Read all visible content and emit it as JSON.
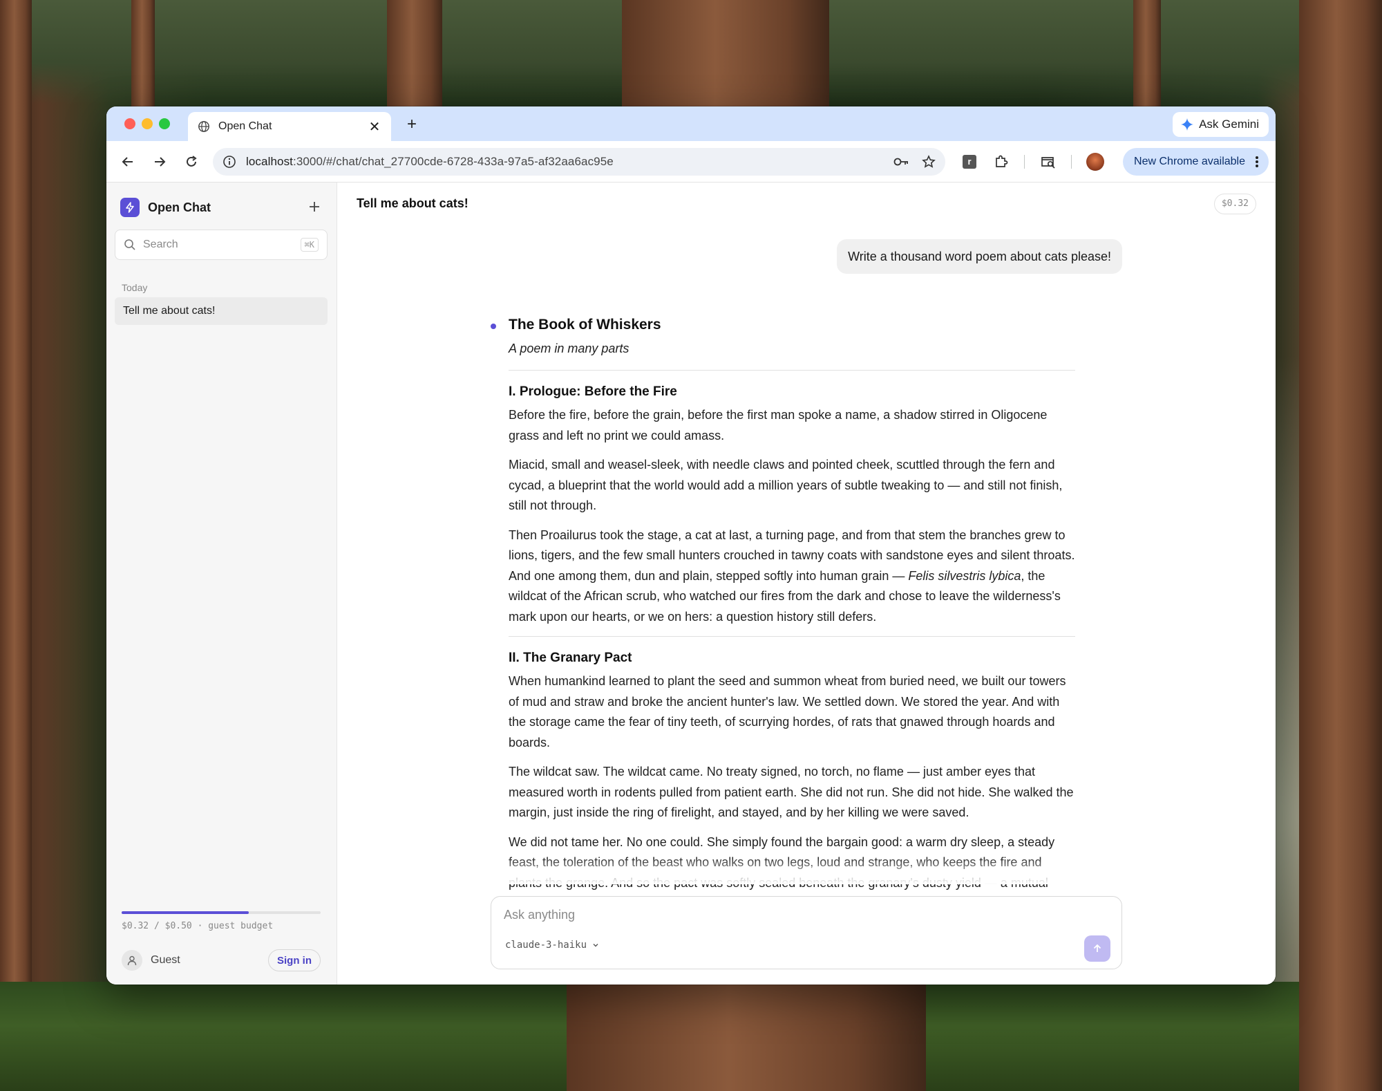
{
  "browser": {
    "tab_title": "Open Chat",
    "ask_gemini": "Ask Gemini",
    "url_host": "localhost",
    "url_path": ":3000/#/chat/chat_27700cde-6728-433a-97a5-af32aa6ac95e",
    "update_label": "New Chrome available",
    "ext_label": "r"
  },
  "sidebar": {
    "app_name": "Open Chat",
    "search_placeholder": "Search",
    "search_shortcut": "⌘K",
    "section_today": "Today",
    "conversations": [
      {
        "title": "Tell me about cats!"
      }
    ],
    "budget_text": "$0.32 / $0.50 · guest budget",
    "budget_fraction": 0.64,
    "user_name": "Guest",
    "sign_in": "Sign in"
  },
  "chat": {
    "title": "Tell me about cats!",
    "cost": "$0.32",
    "user_message": "Write a thousand word poem about cats please!",
    "poem": {
      "title": "The Book of Whiskers",
      "subtitle": "A poem in many parts",
      "sections": [
        {
          "heading": "I. Prologue: Before the Fire",
          "paragraphs": [
            "Before the fire, before the grain, before the first man spoke a name, a shadow stirred in Oligocene grass and left no print we could amass.",
            "Miacid, small and weasel-sleek, with needle claws and pointed cheek, scuttled through the fern and cycad, a blueprint that the world would add a million years of subtle tweaking to — and still not finish, still not through.",
            "Then Proailurus took the stage, a cat at last, a turning page, and from that stem the branches grew to lions, tigers, and the few small hunters crouched in tawny coats with sandstone eyes and silent throats. And one among them, dun and plain, stepped softly into human grain — "
          ],
          "para3_italic": "Felis silvestris lybica",
          "para3_rest": ", the wildcat of the African scrub, who watched our fires from the dark and chose to leave the wilderness's mark upon our hearts, or we on hers: a question history still defers."
        },
        {
          "heading": "II. The Granary Pact",
          "paragraphs": [
            "When humankind learned to plant the seed and summon wheat from buried need, we built our towers of mud and straw and broke the ancient hunter's law. We settled down. We stored the year. And with the storage came the fear of tiny teeth, of scurrying hordes, of rats that gnawed through hoards and boards.",
            "The wildcat saw. The wildcat came. No treaty signed, no torch, no flame — just amber eyes that measured worth in rodents pulled from patient earth. She did not run. She did not hide. She walked the margin, just inside the ring of firelight, and stayed, and by her killing we were saved.",
            "We did not tame her. No one could. She simply found the bargain good: a warm dry sleep, a steady feast, the toleration of the beast who walks on two legs, loud and strange, who keeps the fire and plants the grange. And so the pact was softly sealed beneath the granary's dusty yield — a mutual shrug, a"
          ]
        }
      ]
    },
    "composer_placeholder": "Ask anything",
    "model": "claude-3-haiku"
  },
  "colors": {
    "accent": "#5b4fd6",
    "tabstrip": "#d3e3fd",
    "close": "#ff5f57",
    "minimize": "#febc2e",
    "maximize": "#28c840"
  }
}
